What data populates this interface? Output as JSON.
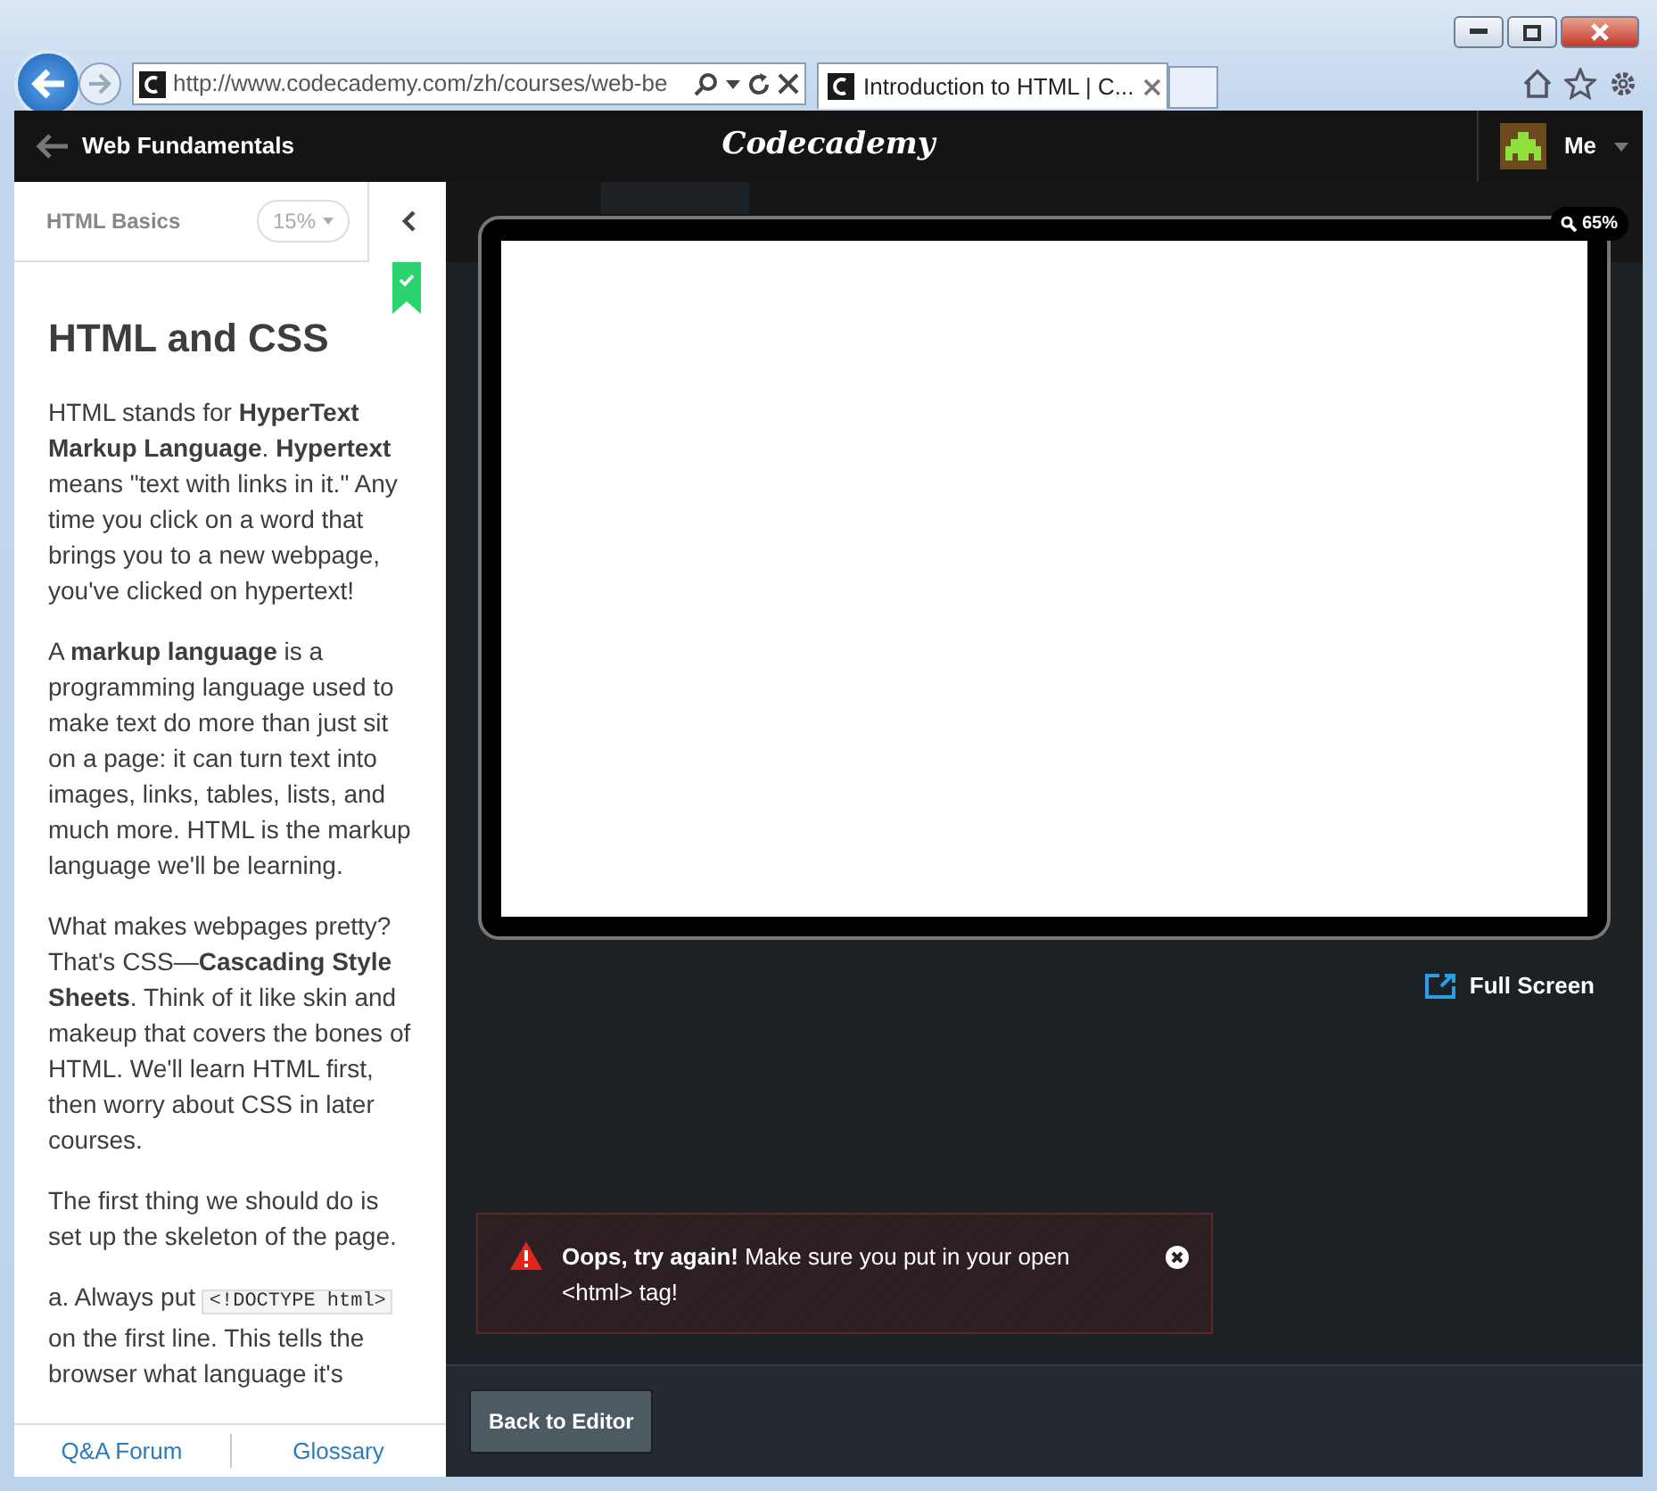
{
  "browser": {
    "address": "http://www.codecademy.com/zh/courses/web-be",
    "tabs": [
      {
        "title": "Introduction to HTML | C...",
        "selected": true
      }
    ]
  },
  "header": {
    "course": "Web Fundamentals",
    "logo": "Codecademy",
    "user": "Me"
  },
  "lesson": {
    "unit": "HTML Basics",
    "progress": "15%",
    "completed": true,
    "title": "HTML and CSS",
    "paragraphs": [
      [
        {
          "kind": "text",
          "text": "HTML stands for **HyperText Markup Language**. **Hypertext** means \"text with links in it.\" Any time you click on a word that brings you to a new webpage, you've clicked on hypertext!"
        }
      ],
      [
        {
          "kind": "text",
          "text": "A **markup language** is a programming language used to make text do more than just sit on a page: it can turn text into images, links, tables, lists, and much more. HTML is the markup language we'll be learning."
        }
      ],
      [
        {
          "kind": "text",
          "text": "What makes webpages pretty? That's CSS—**Cascading Style Sheets**. Think of it like skin and makeup that covers the bones of HTML. We'll learn HTML first, then worry about CSS in later courses."
        }
      ],
      [
        {
          "kind": "text",
          "text": "The first thing we should do is set up the skeleton of the page."
        }
      ],
      [
        {
          "kind": "text",
          "text": "a. Always put "
        },
        {
          "kind": "code",
          "text": "<!DOCTYPE html>"
        },
        {
          "kind": "text",
          "text": " on the first line. This tells the browser what language it's"
        }
      ]
    ]
  },
  "footer_links": [
    "Q&A Forum",
    "Glossary"
  ],
  "preview": {
    "zoom": "65%",
    "fullscreen": "Full Screen"
  },
  "alert": {
    "title": "Oops, try again!",
    "message": "Make sure you put in your open <html> tag!"
  },
  "button": "Back to Editor"
}
